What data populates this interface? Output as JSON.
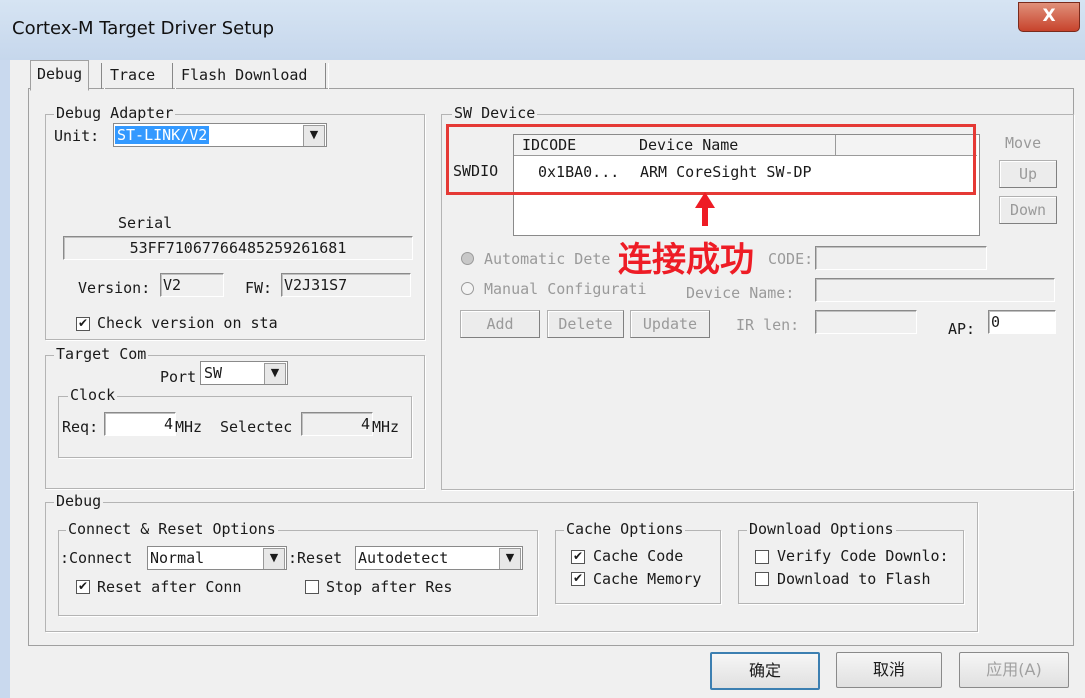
{
  "window": {
    "title": "Cortex-M Target Driver Setup",
    "close_glyph": "X"
  },
  "tabs": [
    {
      "label": "Debug"
    },
    {
      "label": "Trace"
    },
    {
      "label": "Flash Download"
    }
  ],
  "debug_adapter": {
    "group_label": "Debug Adapter",
    "unit_label": "Unit:",
    "unit_value": "ST-LINK/V2",
    "serial_label": "Serial",
    "serial_value": "53FF71067766485259261681",
    "version_label": "Version:",
    "version_value": "V2",
    "fw_label": "FW:",
    "fw_value": "V2J31S7",
    "check_version_label": "Check version on sta",
    "check_version_checked": true
  },
  "target_com": {
    "group_label": "Target Com",
    "port_label": "Port",
    "port_value": "SW",
    "clock_label": "Clock",
    "req_label": "Req:",
    "req_value": "4",
    "req_unit": "MHz",
    "selected_label": "Selectec",
    "selected_value": "4",
    "selected_unit": "MHz"
  },
  "sw_device": {
    "group_label": "SW Device",
    "columns": [
      "IDCODE",
      "Device Name"
    ],
    "row_label": "SWDIO",
    "rows": [
      {
        "idcode": "0x1BA0...",
        "device_name": "ARM CoreSight SW-DP"
      }
    ],
    "move_label": "Move",
    "up_label": "Up",
    "down_label": "Down",
    "auto_detect_label": "Automatic Dete",
    "manual_config_label": "Manual Configurati",
    "idcode_field_label": "CODE:",
    "device_name_label": "Device Name:",
    "add_label": "Add",
    "delete_label": "Delete",
    "update_label": "Update",
    "ir_len_label": "IR len:",
    "ap_label": "AP:",
    "ap_value": "0"
  },
  "annotation": {
    "text": "连接成功",
    "color": "#ee1c25"
  },
  "debug_section": {
    "group_label": "Debug",
    "connect_reset_label": "Connect & Reset Options",
    "connect_label": "Connect:",
    "connect_value": "Normal",
    "reset_label": "Reset:",
    "reset_value": "Autodetect",
    "reset_after_connect_label": "Reset after Conn",
    "reset_after_connect_checked": true,
    "stop_after_reset_label": "Stop after Res",
    "stop_after_reset_checked": false,
    "cache_options_label": "Cache Options",
    "cache_code_label": "Cache Code",
    "cache_code_checked": true,
    "cache_memory_label": "Cache Memory",
    "cache_memory_checked": true,
    "download_options_label": "Download Options",
    "verify_label": "Verify Code Downlo:",
    "verify_checked": false,
    "download_flash_label": "Download to Flash",
    "download_flash_checked": false
  },
  "footer": {
    "ok_label": "确定",
    "cancel_label": "取消",
    "apply_label": "应用(A)"
  },
  "icons": {
    "checkmark": "✔",
    "combo_arrow": "▼",
    "red_arrow": "up-arrow-icon"
  },
  "colors": {
    "selection": "#3399ff",
    "highlight_box": "#e53935"
  }
}
